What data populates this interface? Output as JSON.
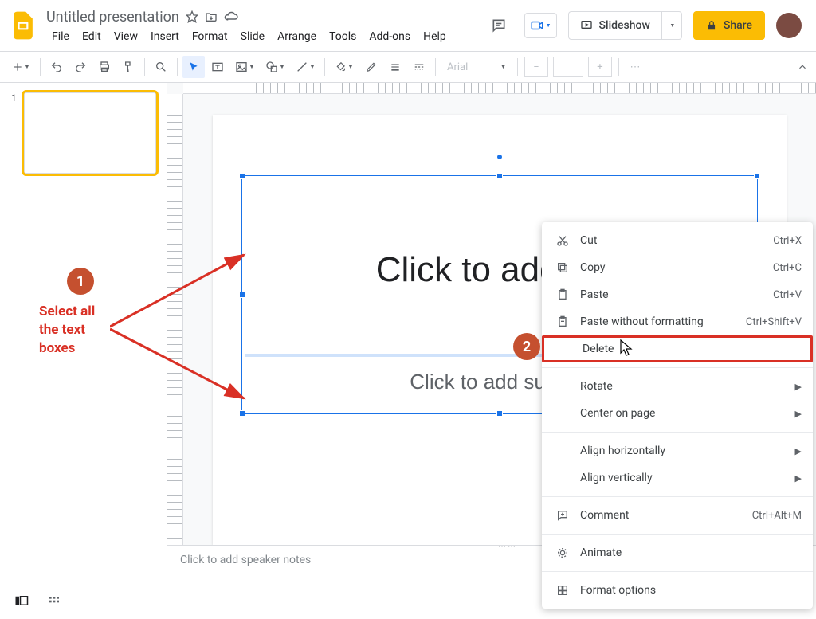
{
  "header": {
    "doc_title": "Untitled presentation",
    "menus": [
      "File",
      "Edit",
      "View",
      "Insert",
      "Format",
      "Slide",
      "Arrange",
      "Tools",
      "Add-ons",
      "Help"
    ],
    "slideshow_label": "Slideshow",
    "share_label": "Share"
  },
  "toolbar": {
    "font_name": "Arial"
  },
  "context_menu": {
    "items": [
      {
        "icon": "cut-icon",
        "label": "Cut",
        "shortcut": "Ctrl+X"
      },
      {
        "icon": "copy-icon",
        "label": "Copy",
        "shortcut": "Ctrl+C"
      },
      {
        "icon": "paste-icon",
        "label": "Paste",
        "shortcut": "Ctrl+V"
      },
      {
        "icon": "paste-plain-icon",
        "label": "Paste without formatting",
        "shortcut": "Ctrl+Shift+V"
      },
      {
        "icon": "",
        "label": "Delete",
        "shortcut": "",
        "highlight": true
      },
      {
        "sep": true
      },
      {
        "icon": "",
        "label": "Rotate",
        "submenu": true
      },
      {
        "icon": "",
        "label": "Center on page",
        "submenu": true
      },
      {
        "sep": true
      },
      {
        "icon": "",
        "label": "Align horizontally",
        "submenu": true
      },
      {
        "icon": "",
        "label": "Align vertically",
        "submenu": true
      },
      {
        "sep": true
      },
      {
        "icon": "comment-icon",
        "label": "Comment",
        "shortcut": "Ctrl+Alt+M"
      },
      {
        "sep": true
      },
      {
        "icon": "animate-icon",
        "label": "Animate",
        "shortcut": ""
      },
      {
        "sep": true
      },
      {
        "icon": "format-options-icon",
        "label": "Format options",
        "shortcut": ""
      }
    ]
  },
  "slide": {
    "title_placeholder": "Click to add title",
    "subtitle_placeholder": "Click to add subtitle"
  },
  "filmstrip": {
    "slides": [
      {
        "number": "1"
      }
    ]
  },
  "annotations": {
    "step1_text": "Select all\nthe text\nboxes"
  },
  "speaker_notes_placeholder": "Click to add speaker notes"
}
